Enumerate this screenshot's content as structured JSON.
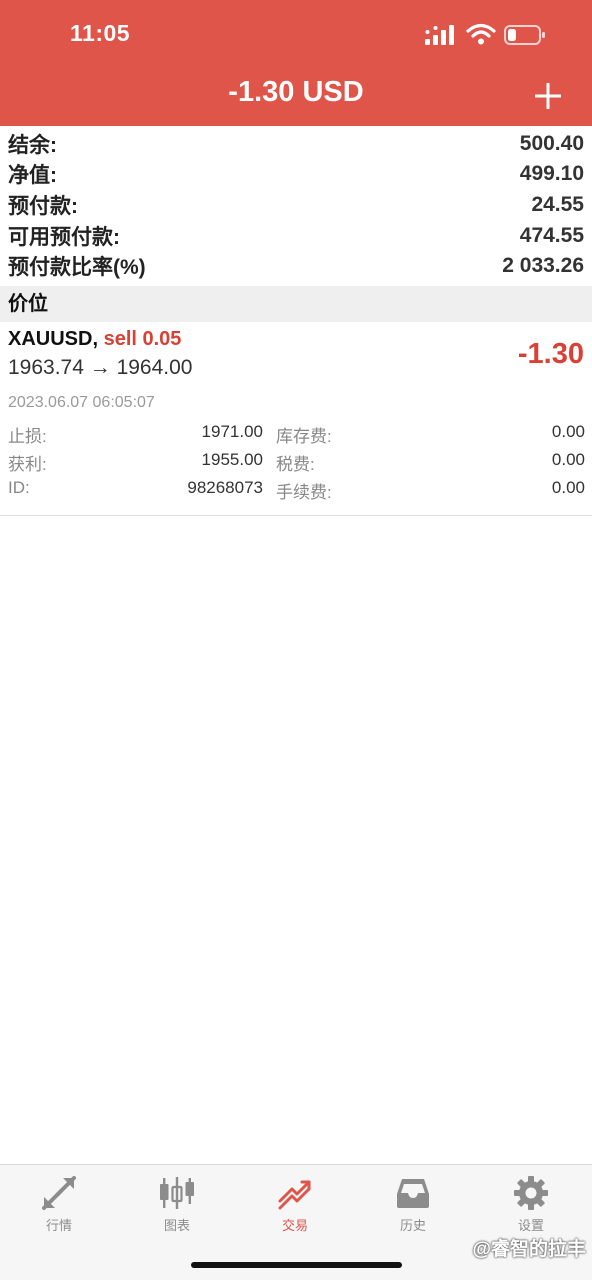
{
  "status_bar": {
    "time": "11:05"
  },
  "header": {
    "title": "-1.30 USD"
  },
  "summary": [
    {
      "label": "结余:",
      "value": "500.40"
    },
    {
      "label": "净值:",
      "value": "499.10"
    },
    {
      "label": "预付款:",
      "value": "24.55"
    },
    {
      "label": "可用预付款:",
      "value": "474.55"
    },
    {
      "label": "预付款比率(%)",
      "value": "2 033.26"
    }
  ],
  "positions_section": {
    "title": "价位"
  },
  "position": {
    "symbol": "XAUUSD,",
    "side": "sell 0.05",
    "prices": "1963.74 → 1964.00",
    "profit": "-1.30",
    "time": "2023.06.07 06:05:07",
    "stop_loss_label": "止损:",
    "stop_loss": "1971.00",
    "take_profit_label": "获利:",
    "take_profit": "1955.00",
    "id_label": "ID:",
    "id": "98268073",
    "swap_label": "库存费:",
    "swap": "0.00",
    "taxes_label": "税费:",
    "taxes": "0.00",
    "commission_label": "手续费:",
    "commission": "0.00"
  },
  "tabbar": {
    "tabs": [
      {
        "label": "行情",
        "icon": "quotes-icon"
      },
      {
        "label": "图表",
        "icon": "chart-candles-icon"
      },
      {
        "label": "交易",
        "icon": "trade-icon"
      },
      {
        "label": "历史",
        "icon": "history-inbox-icon"
      },
      {
        "label": "设置",
        "icon": "settings-gear-icon"
      }
    ],
    "active_index": 2
  },
  "watermark": "@睿智的拉丰",
  "colors": {
    "accent": "#e0554a",
    "loss": "#d84134"
  }
}
